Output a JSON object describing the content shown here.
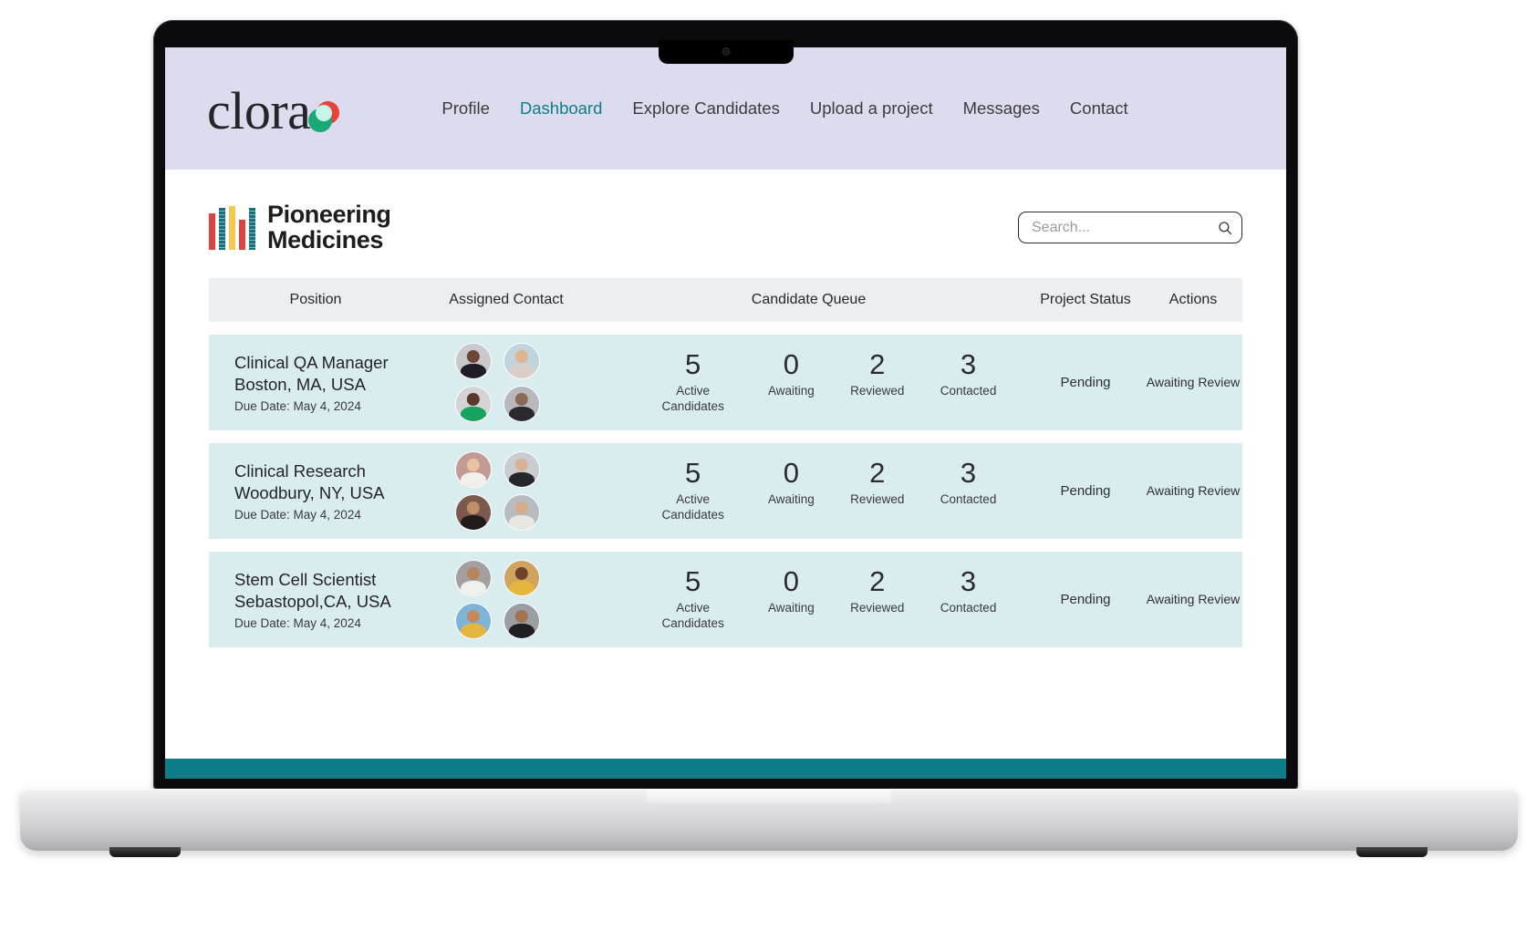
{
  "brand": {
    "wordmark": "clora",
    "logo_colors": {
      "red": "#e8423a",
      "green": "#1aa877",
      "mint": "#c9f5e8"
    }
  },
  "nav": {
    "active": "Dashboard",
    "accent_color": "#0d7d87",
    "bar_color": "#dcdcee",
    "items": [
      {
        "label": "Profile",
        "active": false
      },
      {
        "label": "Dashboard",
        "active": true
      },
      {
        "label": "Explore Candidates",
        "active": false
      },
      {
        "label": "Upload a project",
        "active": false
      },
      {
        "label": "Messages",
        "active": false
      },
      {
        "label": "Contact",
        "active": false
      }
    ]
  },
  "company": {
    "name_line1": "Pioneering",
    "name_line2": "Medicines",
    "bar_colors": [
      "#da4442",
      "#14707d",
      "#f2c94c",
      "#da4442",
      "#14707d"
    ]
  },
  "search": {
    "placeholder": "Search...",
    "value": "",
    "icon": "search-icon"
  },
  "table": {
    "headers": {
      "position": "Position",
      "assigned_contact": "Assigned Contact",
      "candidate_queue": "Candidate Queue",
      "project_status": "Project Status",
      "actions": "Actions"
    },
    "header_bg": "#eceff1",
    "row_bg": "#d9ecee",
    "rows": [
      {
        "position_title": "Clinical QA Manager",
        "location": "Boston, MA, USA",
        "due_date": "Due Date: May 4, 2024",
        "avatars": [
          {
            "name": "avatar-1",
            "bg": "#c9c9cd",
            "skin": "#6d4733",
            "cloth": "#1d1d22"
          },
          {
            "name": "avatar-2",
            "bg": "#bfd4dd",
            "skin": "#e0b48f",
            "cloth": "#d9cfc6"
          },
          {
            "name": "avatar-3",
            "bg": "#d4d4d6",
            "skin": "#5a3a28",
            "cloth": "#18a35f"
          },
          {
            "name": "avatar-4",
            "bg": "#b9b9bd",
            "skin": "#8a6a55",
            "cloth": "#2a2a2e"
          }
        ],
        "queue": [
          {
            "value": "5",
            "label": "Active Candidates",
            "wide": true
          },
          {
            "value": "0",
            "label": "Awaiting",
            "wide": false
          },
          {
            "value": "2",
            "label": "Reviewed",
            "wide": false
          },
          {
            "value": "3",
            "label": "Contacted",
            "wide": false
          }
        ],
        "project_status": "Pending",
        "action": "Awaiting Review"
      },
      {
        "position_title": "Clinical Research",
        "location": "Woodbury, NY, USA",
        "due_date": "Due Date: May 4, 2024",
        "avatars": [
          {
            "name": "avatar-5",
            "bg": "#c49a94",
            "skin": "#e8c3a4",
            "cloth": "#f3efe9"
          },
          {
            "name": "avatar-6",
            "bg": "#c9cdd0",
            "skin": "#d8b194",
            "cloth": "#26262b"
          },
          {
            "name": "avatar-7",
            "bg": "#7a5a4c",
            "skin": "#c08f6a",
            "cloth": "#211c1a"
          },
          {
            "name": "avatar-8",
            "bg": "#b6bcc0",
            "skin": "#d6ab88",
            "cloth": "#e9e6e1"
          }
        ],
        "queue": [
          {
            "value": "5",
            "label": "Active Candidates",
            "wide": true
          },
          {
            "value": "0",
            "label": "Awaiting",
            "wide": false
          },
          {
            "value": "2",
            "label": "Reviewed",
            "wide": false
          },
          {
            "value": "3",
            "label": "Contacted",
            "wide": false
          }
        ],
        "project_status": "Pending",
        "action": "Awaiting Review"
      },
      {
        "position_title": "Stem Cell Scientist",
        "location": "Sebastopol,CA, USA",
        "due_date": "Due Date: May 4, 2024",
        "avatars": [
          {
            "name": "avatar-9",
            "bg": "#a4a0a0",
            "skin": "#b9855c",
            "cloth": "#f0f0ef"
          },
          {
            "name": "avatar-10",
            "bg": "#cfa45e",
            "skin": "#6d4226",
            "cloth": "#e5b63b"
          },
          {
            "name": "avatar-11",
            "bg": "#7fb4d8",
            "skin": "#c48a5e",
            "cloth": "#e6b53f"
          },
          {
            "name": "avatar-12",
            "bg": "#9b9ea2",
            "skin": "#a5724e",
            "cloth": "#1f1f23"
          }
        ],
        "queue": [
          {
            "value": "5",
            "label": "Active Candidates",
            "wide": true
          },
          {
            "value": "0",
            "label": "Awaiting",
            "wide": false
          },
          {
            "value": "2",
            "label": "Reviewed",
            "wide": false
          },
          {
            "value": "3",
            "label": "Contacted",
            "wide": false
          }
        ],
        "project_status": "Pending",
        "action": "Awaiting Review"
      }
    ]
  },
  "footer": {
    "band_color": "#0d7d87"
  }
}
